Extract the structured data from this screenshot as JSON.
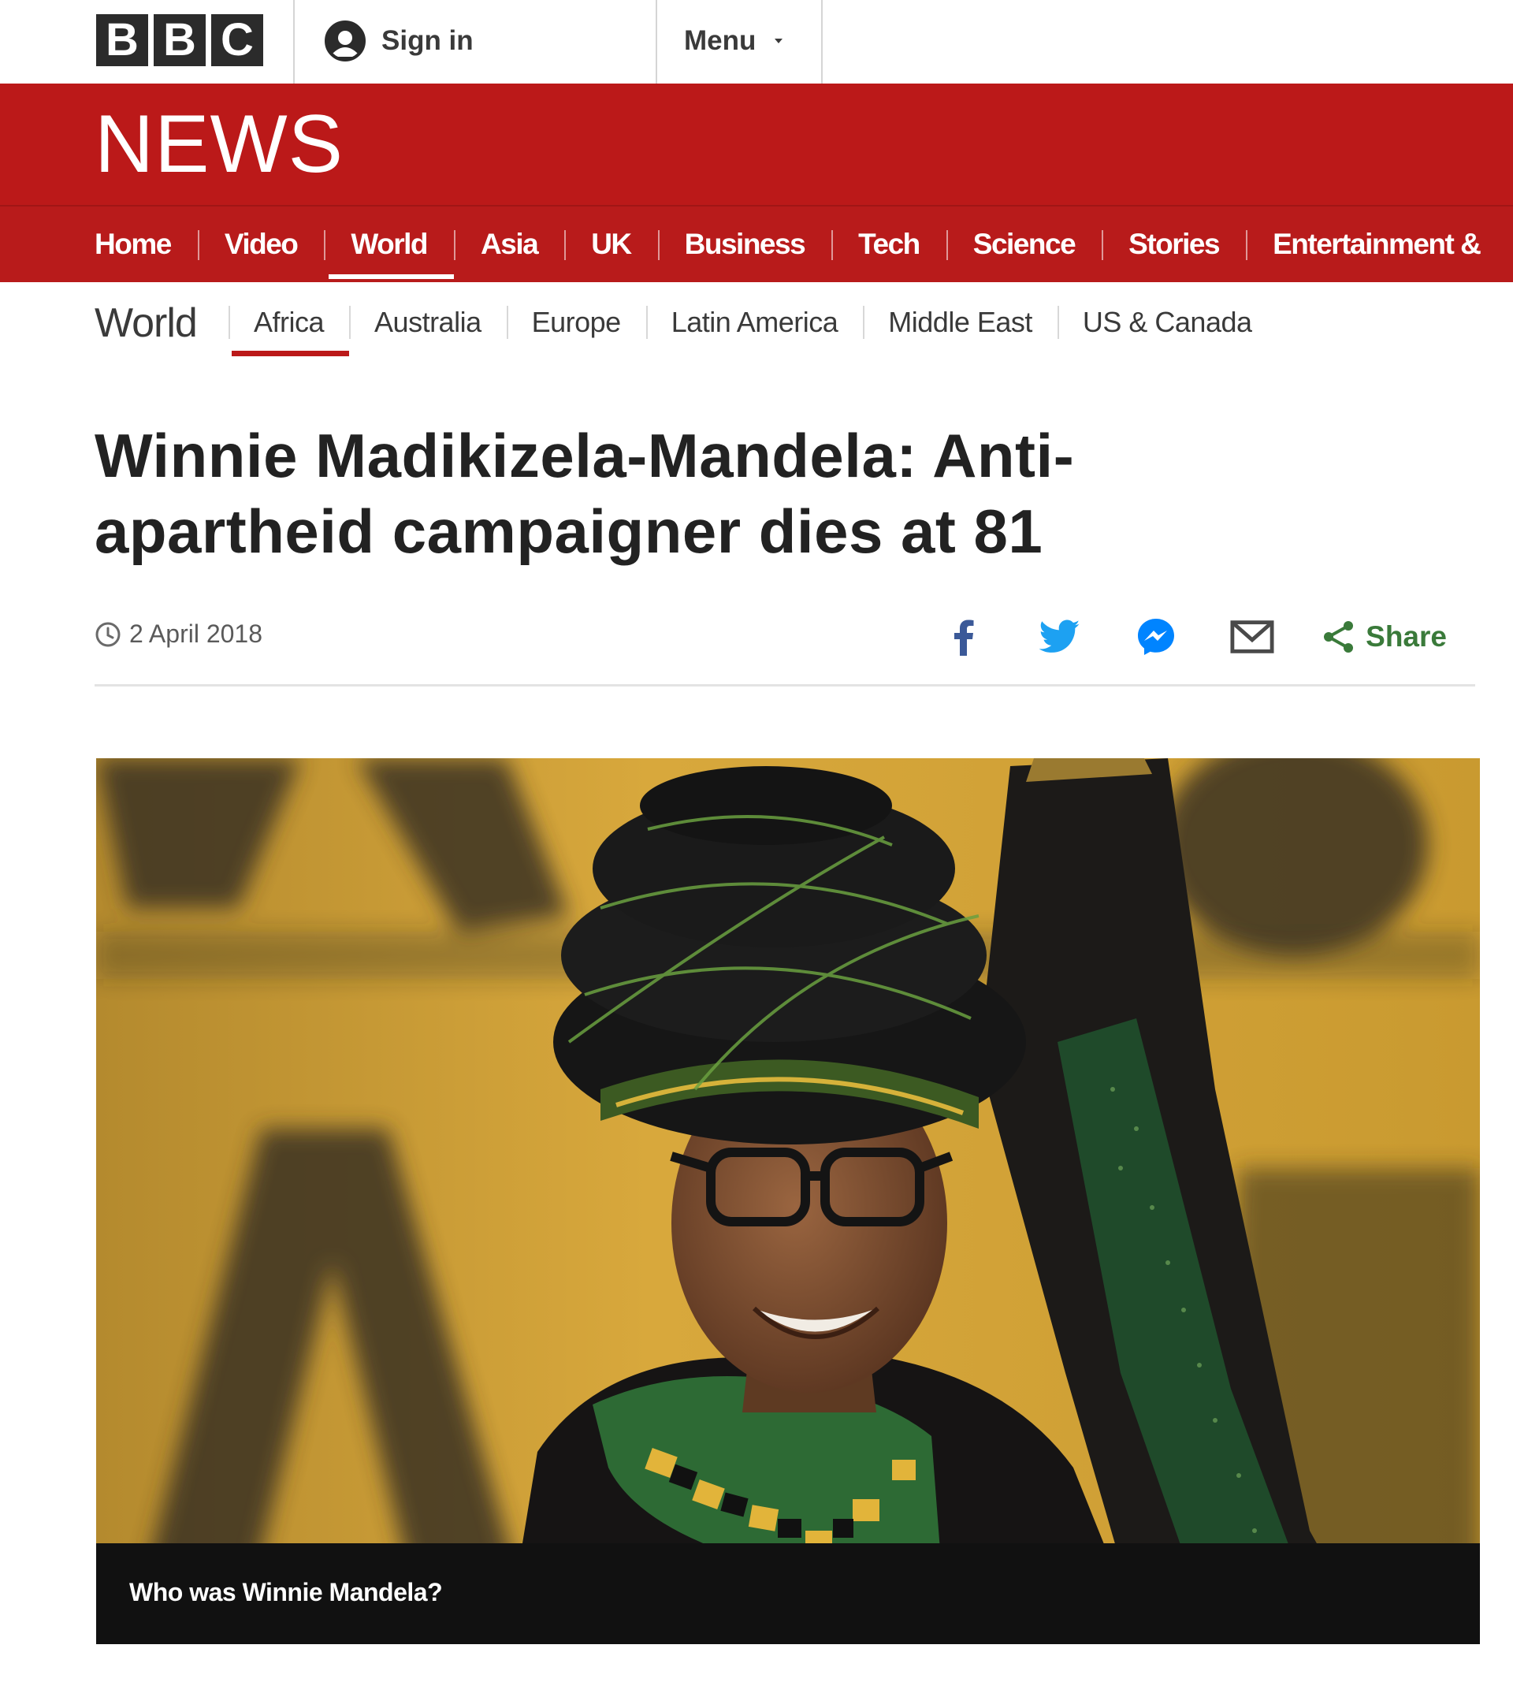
{
  "topbar": {
    "logo_letters": [
      "B",
      "B",
      "C"
    ],
    "signin_label": "Sign in",
    "menu_label": "Menu"
  },
  "newsband": {
    "title": "NEWS"
  },
  "primary_nav": {
    "items": [
      {
        "label": "Home"
      },
      {
        "label": "Video"
      },
      {
        "label": "World",
        "active": true
      },
      {
        "label": "Asia"
      },
      {
        "label": "UK"
      },
      {
        "label": "Business"
      },
      {
        "label": "Tech"
      },
      {
        "label": "Science"
      },
      {
        "label": "Stories"
      },
      {
        "label": "Entertainment &"
      }
    ]
  },
  "secondary_nav": {
    "section_title": "World",
    "items": [
      {
        "label": "Africa",
        "active": true
      },
      {
        "label": "Australia"
      },
      {
        "label": "Europe"
      },
      {
        "label": "Latin America"
      },
      {
        "label": "Middle East"
      },
      {
        "label": "US & Canada"
      }
    ]
  },
  "article": {
    "headline": "Winnie Madikizela-Mandela: Anti-apartheid campaigner dies at 81",
    "date": "2 April 2018",
    "share_label": "Share",
    "share_icons": [
      "facebook-icon",
      "twitter-icon",
      "messenger-icon",
      "email-icon"
    ],
    "image_caption": "Who was Winnie Mandela?"
  },
  "colors": {
    "bbc_red": "#bb1919",
    "nav_red": "#b81b1b",
    "facebook": "#3b5998",
    "twitter": "#1da1f2",
    "messenger": "#0084ff",
    "share_green": "#3a7a3a"
  }
}
